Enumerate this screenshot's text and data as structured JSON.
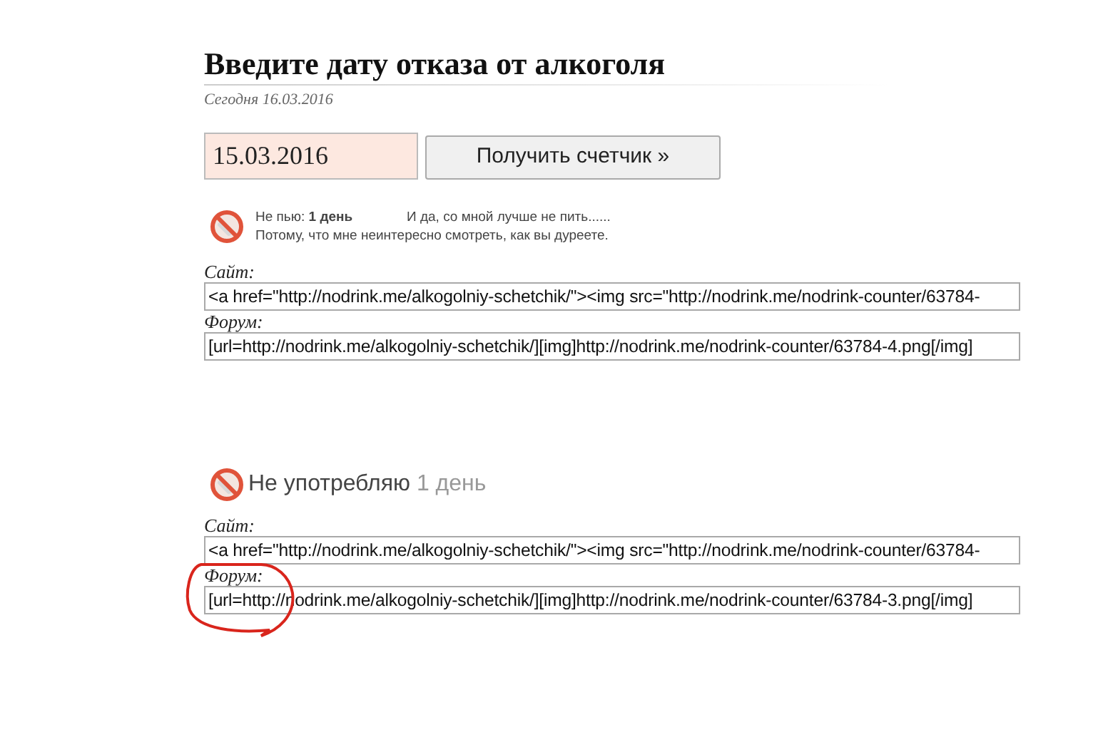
{
  "title": "Введите дату отказа от алкоголя",
  "today": "Сегодня 16.03.2016",
  "date_field": {
    "value": "15.03.2016"
  },
  "submit_button": "Получить счетчик »",
  "counters": [
    {
      "kind": "small",
      "status_label": "Не пью:",
      "status_value": "1 день",
      "slogan": [
        "И да, со мной лучше не пить......",
        "Потому, что мне неинтересно смотреть, как вы дуреете."
      ],
      "fields": [
        {
          "label": "Сайт:",
          "value": "<a href=\"http://nodrink.me/alkogolniy-schetchik/\"><img src=\"http://nodrink.me/nodrink-counter/63784-"
        },
        {
          "label": "Форум:",
          "value": "[url=http://nodrink.me/alkogolniy-schetchik/][img]http://nodrink.me/nodrink-counter/63784-4.png[/img]"
        }
      ]
    },
    {
      "kind": "large",
      "status_label": "Не употребляю",
      "status_value": "1 день",
      "fields": [
        {
          "label": "Сайт:",
          "value": "<a href=\"http://nodrink.me/alkogolniy-schetchik/\"><img src=\"http://nodrink.me/nodrink-counter/63784-"
        },
        {
          "label": "Форум:",
          "value": "[url=http://nodrink.me/alkogolniy-schetchik/][img]http://nodrink.me/nodrink-counter/63784-3.png[/img]"
        }
      ]
    }
  ]
}
